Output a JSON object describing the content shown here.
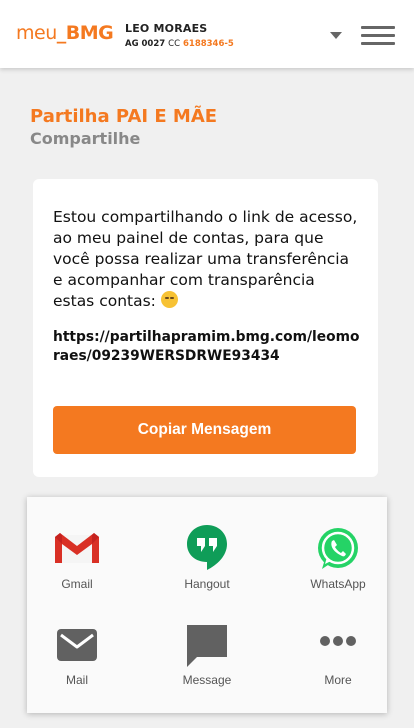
{
  "header": {
    "logo_text_meu": "meu",
    "logo_text_sep": "_",
    "logo_text_bmg": "BMG",
    "user_name": "LEO MORAES",
    "agency_label": "AG 0027",
    "cc_label": "CC",
    "account_number": "6188346-5",
    "icons": {
      "dropdown": "caret-down-icon",
      "menu": "hamburger-menu-icon"
    }
  },
  "page": {
    "title": "Partilha PAI E MÃE",
    "subtitle": "Compartilhe"
  },
  "card": {
    "message": "Estou compartilhando o link de acesso, ao meu painel de contas, para que você possa realizar uma transferência e acompanhar com transparência estas contas:",
    "emoji_icon": "smirk-emoji-icon",
    "link": "https://partilhapramim.bmg.com/leomoraes/09239WERSDRWE93434",
    "copy_button": "Copiar Mensagem"
  },
  "share_sheet": {
    "items": [
      {
        "label": "Gmail",
        "icon": "gmail-icon"
      },
      {
        "label": "Hangout",
        "icon": "hangouts-icon"
      },
      {
        "label": "WhatsApp",
        "icon": "whatsapp-icon"
      },
      {
        "label": "Mail",
        "icon": "mail-icon"
      },
      {
        "label": "Message",
        "icon": "message-icon"
      },
      {
        "label": "More",
        "icon": "more-icon"
      }
    ]
  },
  "colors": {
    "brand_orange": "#f47920",
    "hangout_green": "#0f9d58",
    "whatsapp_green": "#25d366",
    "gmail_red": "#d93025"
  }
}
